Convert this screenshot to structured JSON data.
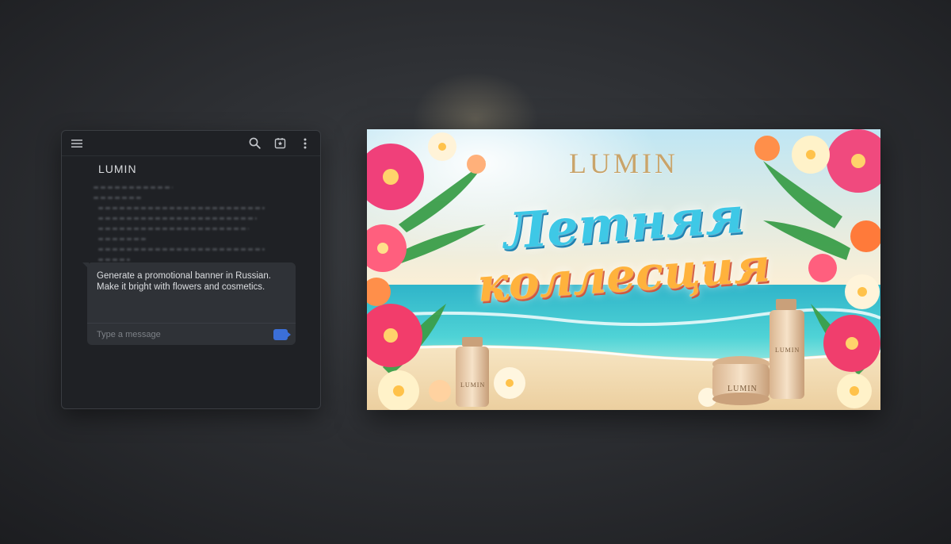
{
  "toolbar": {
    "menu_icon": "menu-icon",
    "search_icon": "search-icon",
    "bookmark_icon": "bookmark-star-icon",
    "more_icon": "more-vertical-icon"
  },
  "chat": {
    "brand": "LUMIN",
    "message": "Generate a promotional banner in Russian. Make it bright with flowers and cosmetics.",
    "input_placeholder": "Type a message"
  },
  "banner": {
    "logo": "LUMIN",
    "headline_line1": "Летняя",
    "headline_line2": "коллесция",
    "product_label": "LUMIN"
  },
  "colors": {
    "page_bg": "#2e3034",
    "panel_bg": "#1f2125",
    "bubble_bg": "#2f3237",
    "send_button": "#3b6fd8",
    "logo_gold": "#c9a46a",
    "headline_blue": "#3ec8e6",
    "headline_orange": "#ffb23c"
  }
}
